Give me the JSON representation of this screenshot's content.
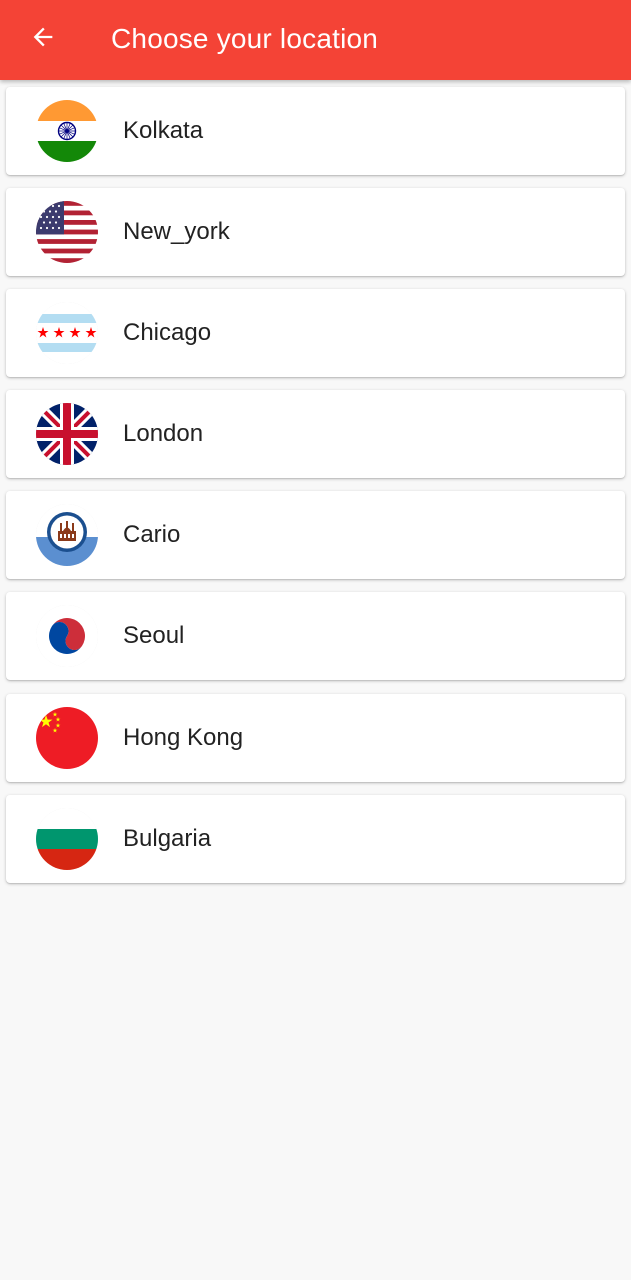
{
  "appbar": {
    "title": "Choose your location",
    "back_icon": "arrow-left-icon",
    "background": "#f44336"
  },
  "locations": [
    {
      "name": "Kolkata",
      "flag": "india-flag-icon"
    },
    {
      "name": "New_york",
      "flag": "usa-flag-icon"
    },
    {
      "name": "Chicago",
      "flag": "chicago-flag-icon"
    },
    {
      "name": "London",
      "flag": "uk-flag-icon"
    },
    {
      "name": "Cario",
      "flag": "cairo-emblem-icon"
    },
    {
      "name": "Seoul",
      "flag": "south-korea-flag-icon"
    },
    {
      "name": "Hong Kong",
      "flag": "china-flag-icon"
    },
    {
      "name": "Bulgaria",
      "flag": "bulgaria-flag-icon"
    }
  ]
}
